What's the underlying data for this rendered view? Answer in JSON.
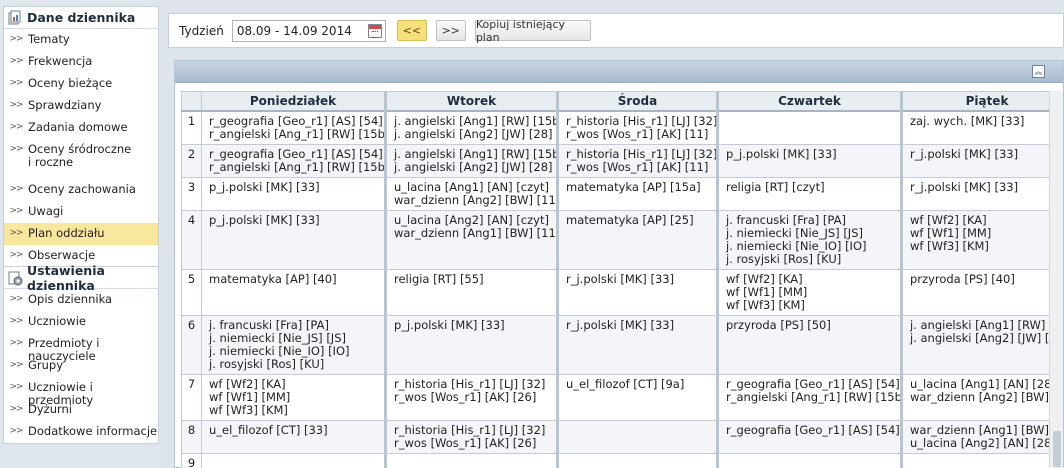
{
  "sidebar": {
    "section1": {
      "title": "Dane dziennika",
      "items": [
        {
          "label": "Tematy"
        },
        {
          "label": "Frekwencja"
        },
        {
          "label": "Oceny bieżące"
        },
        {
          "label": "Sprawdziany"
        },
        {
          "label": "Zadania domowe"
        },
        {
          "label": "Oceny śródroczne\ni roczne"
        },
        {
          "label": "Oceny zachowania"
        },
        {
          "label": "Uwagi"
        },
        {
          "label": "Plan oddziału"
        },
        {
          "label": "Obserwacje"
        }
      ]
    },
    "section2": {
      "title": "Ustawienia dziennika",
      "items": [
        {
          "label": "Opis dziennika"
        },
        {
          "label": "Uczniowie"
        },
        {
          "label": "Przedmioty i nauczyciele"
        },
        {
          "label": "Grupy"
        },
        {
          "label": "Uczniowie i przedmioty"
        },
        {
          "label": "Dyżurni"
        },
        {
          "label": "Dodatkowe informacje"
        }
      ]
    },
    "arrow_glyph": ">>"
  },
  "toolbar": {
    "week_label": "Tydzień",
    "week_value": "08.09 - 14.09 2014",
    "prev_label": "<<",
    "next_label": ">>",
    "copy_label": "Kopiuj istniejący plan"
  },
  "schedule": {
    "collapse_glyph": "︽",
    "days": [
      "Poniedziałek",
      "Wtorek",
      "Środa",
      "Czwartek",
      "Piątek"
    ],
    "rows": [
      {
        "n": "1",
        "cells": [
          "r_geografia [Geo_r1] [AS] [54]\nr_angielski [Ang_r1] [RW] [15b]",
          "j. angielski [Ang1] [RW] [15b]\nj. angielski [Ang2] [JW] [28]",
          "r_historia [His_r1] [LJ] [32]\nr_wos [Wos_r1] [AK] [11]",
          "",
          "zaj. wych. [MK] [33]"
        ]
      },
      {
        "n": "2",
        "cells": [
          "r_geografia [Geo_r1] [AS] [54]\nr_angielski [Ang_r1] [RW] [15b]",
          "j. angielski [Ang1] [RW] [15b]\nj. angielski [Ang2] [JW] [28]",
          "r_historia [His_r1] [LJ] [32]\nr_wos [Wos_r1] [AK] [11]",
          "p_j.polski [MK] [33]",
          "r_j.polski [MK] [33]"
        ]
      },
      {
        "n": "3",
        "cells": [
          "p_j.polski [MK] [33]",
          "u_lacina [Ang1] [AN] [czyt]\nwar_dzienn [Ang2] [BW] [11]",
          "matematyka [AP] [15a]",
          "religia [RT] [czyt]",
          "r_j.polski [MK] [33]"
        ]
      },
      {
        "n": "4",
        "cells": [
          "p_j.polski [MK] [33]",
          "u_lacina [Ang2] [AN] [czyt]\nwar_dzienn [Ang1] [BW] [11]",
          "matematyka [AP] [25]",
          "j. francuski [Fra] [PA]\nj. niemiecki [Nie_JS] [JS]\nj. niemiecki [Nie_IO] [IO]\nj. rosyjski [Ros] [KU]",
          "wf [Wf2] [KA]\nwf [Wf1] [MM]\nwf [Wf3] [KM]"
        ]
      },
      {
        "n": "5",
        "cells": [
          "matematyka [AP] [40]",
          "religia [RT] [55]",
          "r_j.polski [MK] [33]",
          "wf [Wf2] [KA]\nwf [Wf1] [MM]\nwf [Wf3] [KM]",
          "przyroda [PS] [40]"
        ]
      },
      {
        "n": "6",
        "cells": [
          "j. francuski [Fra] [PA]\nj. niemiecki [Nie_JS] [JS]\nj. niemiecki [Nie_IO] [IO]\nj. rosyjski [Ros] [KU]",
          "p_j.polski [MK] [33]",
          "r_j.polski [MK] [33]",
          "przyroda [PS] [50]",
          "j. angielski [Ang1] [RW] [1\nj. angielski [Ang2] [JW] [2"
        ]
      },
      {
        "n": "7",
        "cells": [
          "wf [Wf2] [KA]\nwf [Wf1] [MM]\nwf [Wf3] [KM]",
          "r_historia [His_r1] [LJ] [32]\nr_wos [Wos_r1] [AK] [26]",
          "u_el_filozof [CT] [9a]",
          "r_geografia [Geo_r1] [AS] [54]\nr_angielski [Ang_r1] [RW] [15b]",
          "u_lacina [Ang1] [AN] [28]\nwar_dzienn [Ang2] [BW] [1"
        ]
      },
      {
        "n": "8",
        "cells": [
          "u_el_filozof [CT] [33]",
          "r_historia [His_r1] [LJ] [32]\nr_wos [Wos_r1] [AK] [26]",
          "",
          "r_geografia [Geo_r1] [AS] [54]",
          "war_dzienn [Ang1] [BW] [1\nu_lacina [Ang2] [AN] [28]"
        ]
      },
      {
        "n": "9",
        "cells": [
          "",
          "",
          "",
          "",
          ""
        ]
      }
    ]
  }
}
